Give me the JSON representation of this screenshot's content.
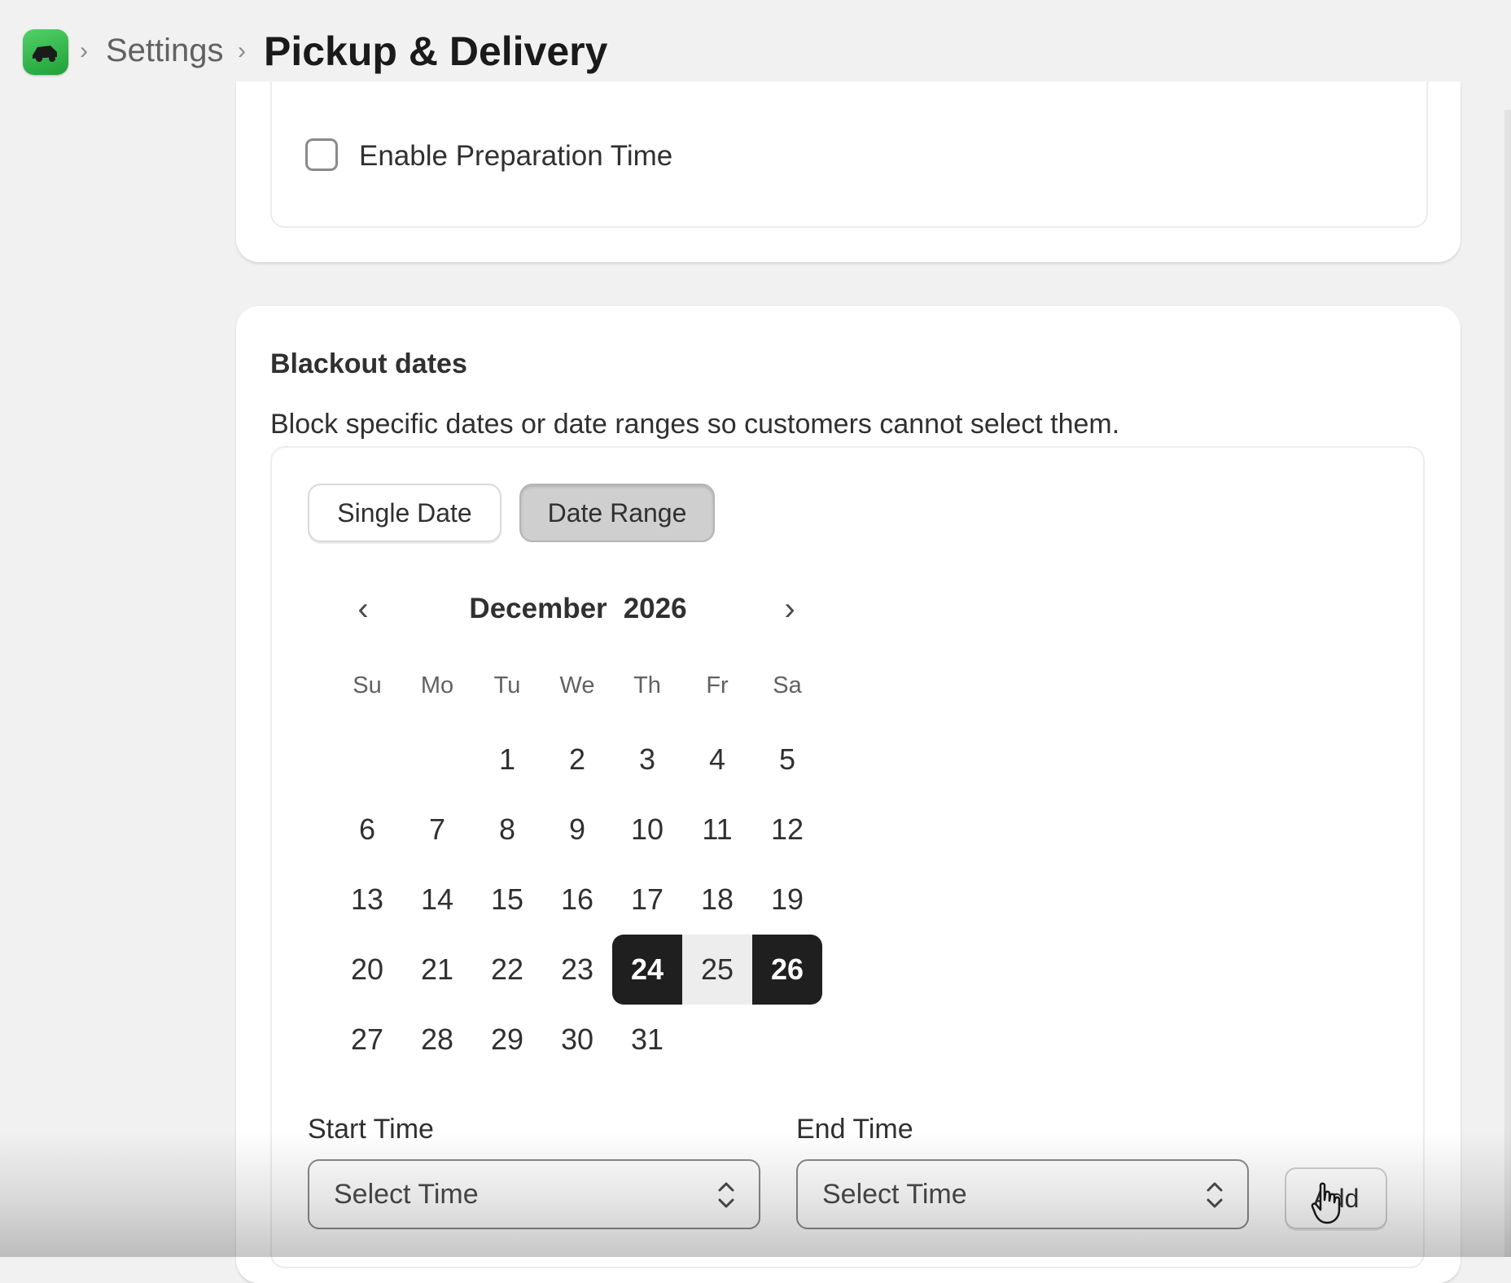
{
  "header": {
    "app_icon": "app-logo-icon",
    "breadcrumb_sep": "›",
    "settings_label": "Settings",
    "page_title": "Pickup & Delivery"
  },
  "prep": {
    "checkbox_label": "Enable Preparation Time",
    "checked": false
  },
  "blackout": {
    "title": "Blackout dates",
    "description": "Block specific dates or date ranges so customers cannot select them.",
    "mode_single": "Single Date",
    "mode_range": "Date Range",
    "active_mode": "Date Range"
  },
  "calendar": {
    "month": "December",
    "year": "2026",
    "prev_icon": "‹",
    "next_icon": "›",
    "weekdays": [
      "Su",
      "Mo",
      "Tu",
      "We",
      "Th",
      "Fr",
      "Sa"
    ],
    "first_weekday_index": 2,
    "days_in_month": 31,
    "range_start": 24,
    "range_end": 26
  },
  "time": {
    "start_label": "Start Time",
    "end_label": "End Time",
    "start_value": "Select Time",
    "end_value": "Select Time",
    "add_label": "Add"
  },
  "colors": {
    "selected_bg": "#1f1f1f",
    "range_bg": "#ededed",
    "page_bg": "#f1f1f1",
    "brand_green": "#2fb349"
  }
}
